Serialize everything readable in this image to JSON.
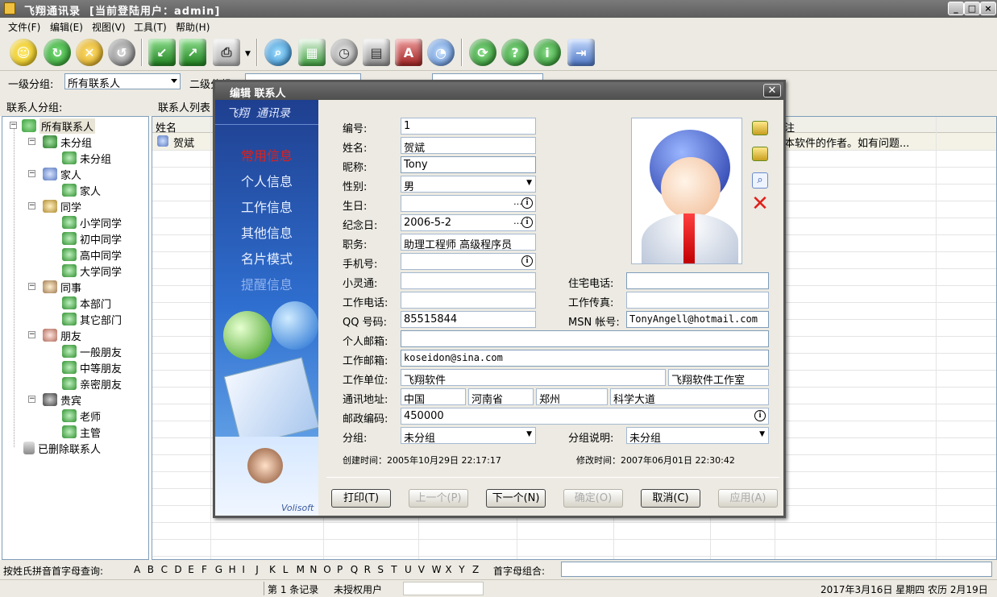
{
  "window": {
    "title": "飞翔通讯录  [当前登陆用户：admin]"
  },
  "menu": [
    "文件(F)",
    "编辑(E)",
    "视图(V)",
    "工具(T)",
    "帮助(H)"
  ],
  "filter": {
    "group1_label": "一级分组:",
    "group1_value": "所有联系人",
    "group2_label": "二级分组"
  },
  "panels": {
    "tree_header": "联系人分组:",
    "list_header": "联系人列表"
  },
  "tree": [
    {
      "label": "所有联系人",
      "level": 0
    },
    {
      "label": "未分组",
      "level": 1
    },
    {
      "label": "未分组",
      "level": 2
    },
    {
      "label": "家人",
      "level": 1
    },
    {
      "label": "家人",
      "level": 2
    },
    {
      "label": "同学",
      "level": 1
    },
    {
      "label": "小学同学",
      "level": 2
    },
    {
      "label": "初中同学",
      "level": 2
    },
    {
      "label": "高中同学",
      "level": 2
    },
    {
      "label": "大学同学",
      "level": 2
    },
    {
      "label": "同事",
      "level": 1
    },
    {
      "label": "本部门",
      "level": 2
    },
    {
      "label": "其它部门",
      "level": 2
    },
    {
      "label": "朋友",
      "level": 1
    },
    {
      "label": "一般朋友",
      "level": 2
    },
    {
      "label": "中等朋友",
      "level": 2
    },
    {
      "label": "亲密朋友",
      "level": 2
    },
    {
      "label": "贵宾",
      "level": 1
    },
    {
      "label": "老师",
      "level": 2
    },
    {
      "label": "主管",
      "level": 2
    },
    {
      "label": "已删除联系人",
      "level": 0
    }
  ],
  "grid": {
    "col_name": "姓名",
    "col_note": "注",
    "row_name": "贺斌",
    "row_note": "本软件的作者。如有问题..."
  },
  "alphabet": {
    "label": "按姓氏拼音首字母查询:",
    "letters": [
      "A",
      "B",
      "C",
      "D",
      "E",
      "F",
      "G",
      "H",
      "I",
      "J",
      "K",
      "L",
      "M",
      "N",
      "O",
      "P",
      "Q",
      "R",
      "S",
      "T",
      "U",
      "V",
      "W",
      "X",
      "Y",
      "Z"
    ],
    "combo_label": "首字母组合:"
  },
  "status": {
    "records": "第 1 条记录",
    "license": "未授权用户",
    "date": "2017年3月16日 星期四 农历 2月19日"
  },
  "dialog": {
    "title": "编辑 联系人",
    "logo": "飞翔  通讯录",
    "sidebar": [
      "常用信息",
      "个人信息",
      "工作信息",
      "其他信息",
      "名片模式",
      "提醒信息"
    ],
    "brand": "Volisoft",
    "fields": {
      "id": {
        "label": "编号:",
        "value": "1"
      },
      "name": {
        "label": "姓名:",
        "value": "贺斌"
      },
      "nickname": {
        "label": "昵称:",
        "value": "Tony"
      },
      "gender": {
        "label": "性别:",
        "value": "男"
      },
      "birthday": {
        "label": "生日:",
        "value": ""
      },
      "anniversary": {
        "label": "纪念日:",
        "value": "2006-5-2"
      },
      "title": {
        "label": "职务:",
        "value": "助理工程师 高级程序员"
      },
      "mobile": {
        "label": "手机号:",
        "value": ""
      },
      "phs": {
        "label": "小灵通:",
        "value": ""
      },
      "work_phone": {
        "label": "工作电话:",
        "value": ""
      },
      "qq": {
        "label": "QQ 号码:",
        "value": "85515844"
      },
      "home_phone": {
        "label": "住宅电话:",
        "value": ""
      },
      "work_fax": {
        "label": "工作传真:",
        "value": ""
      },
      "msn": {
        "label": "MSN 帐号:",
        "value": "TonyAngell@hotmail.com"
      },
      "personal_email": {
        "label": "个人邮箱:",
        "value": ""
      },
      "work_email": {
        "label": "工作邮箱:",
        "value": "koseidon@sina.com"
      },
      "company": {
        "label": "工作单位:",
        "value": "飞翔软件",
        "dept": "飞翔软件工作室"
      },
      "address": {
        "label": "通讯地址:",
        "country": "中国",
        "province": "河南省",
        "city": "郑州",
        "street": "科学大道"
      },
      "zip": {
        "label": "邮政编码:",
        "value": "450000"
      },
      "group": {
        "label": "分组:",
        "value": "未分组"
      },
      "group_desc": {
        "label": "分组说明:",
        "value": "未分组"
      }
    },
    "created": "创建时间：2005年10月29日 22:17:17",
    "modified": "修改时间：2007年06月01日 22:30:42",
    "buttons": {
      "print": "打印(T)",
      "prev": "上一个(P)",
      "next": "下一个(N)",
      "ok": "确定(O)",
      "cancel": "取消(C)",
      "apply": "应用(A)"
    },
    "date_picker_glyph": "…",
    "info_glyph": "i"
  },
  "colors": {
    "accent_red": "#e0201a",
    "title_gray": "#5d5d5d",
    "panel_bg": "#eceae2"
  }
}
